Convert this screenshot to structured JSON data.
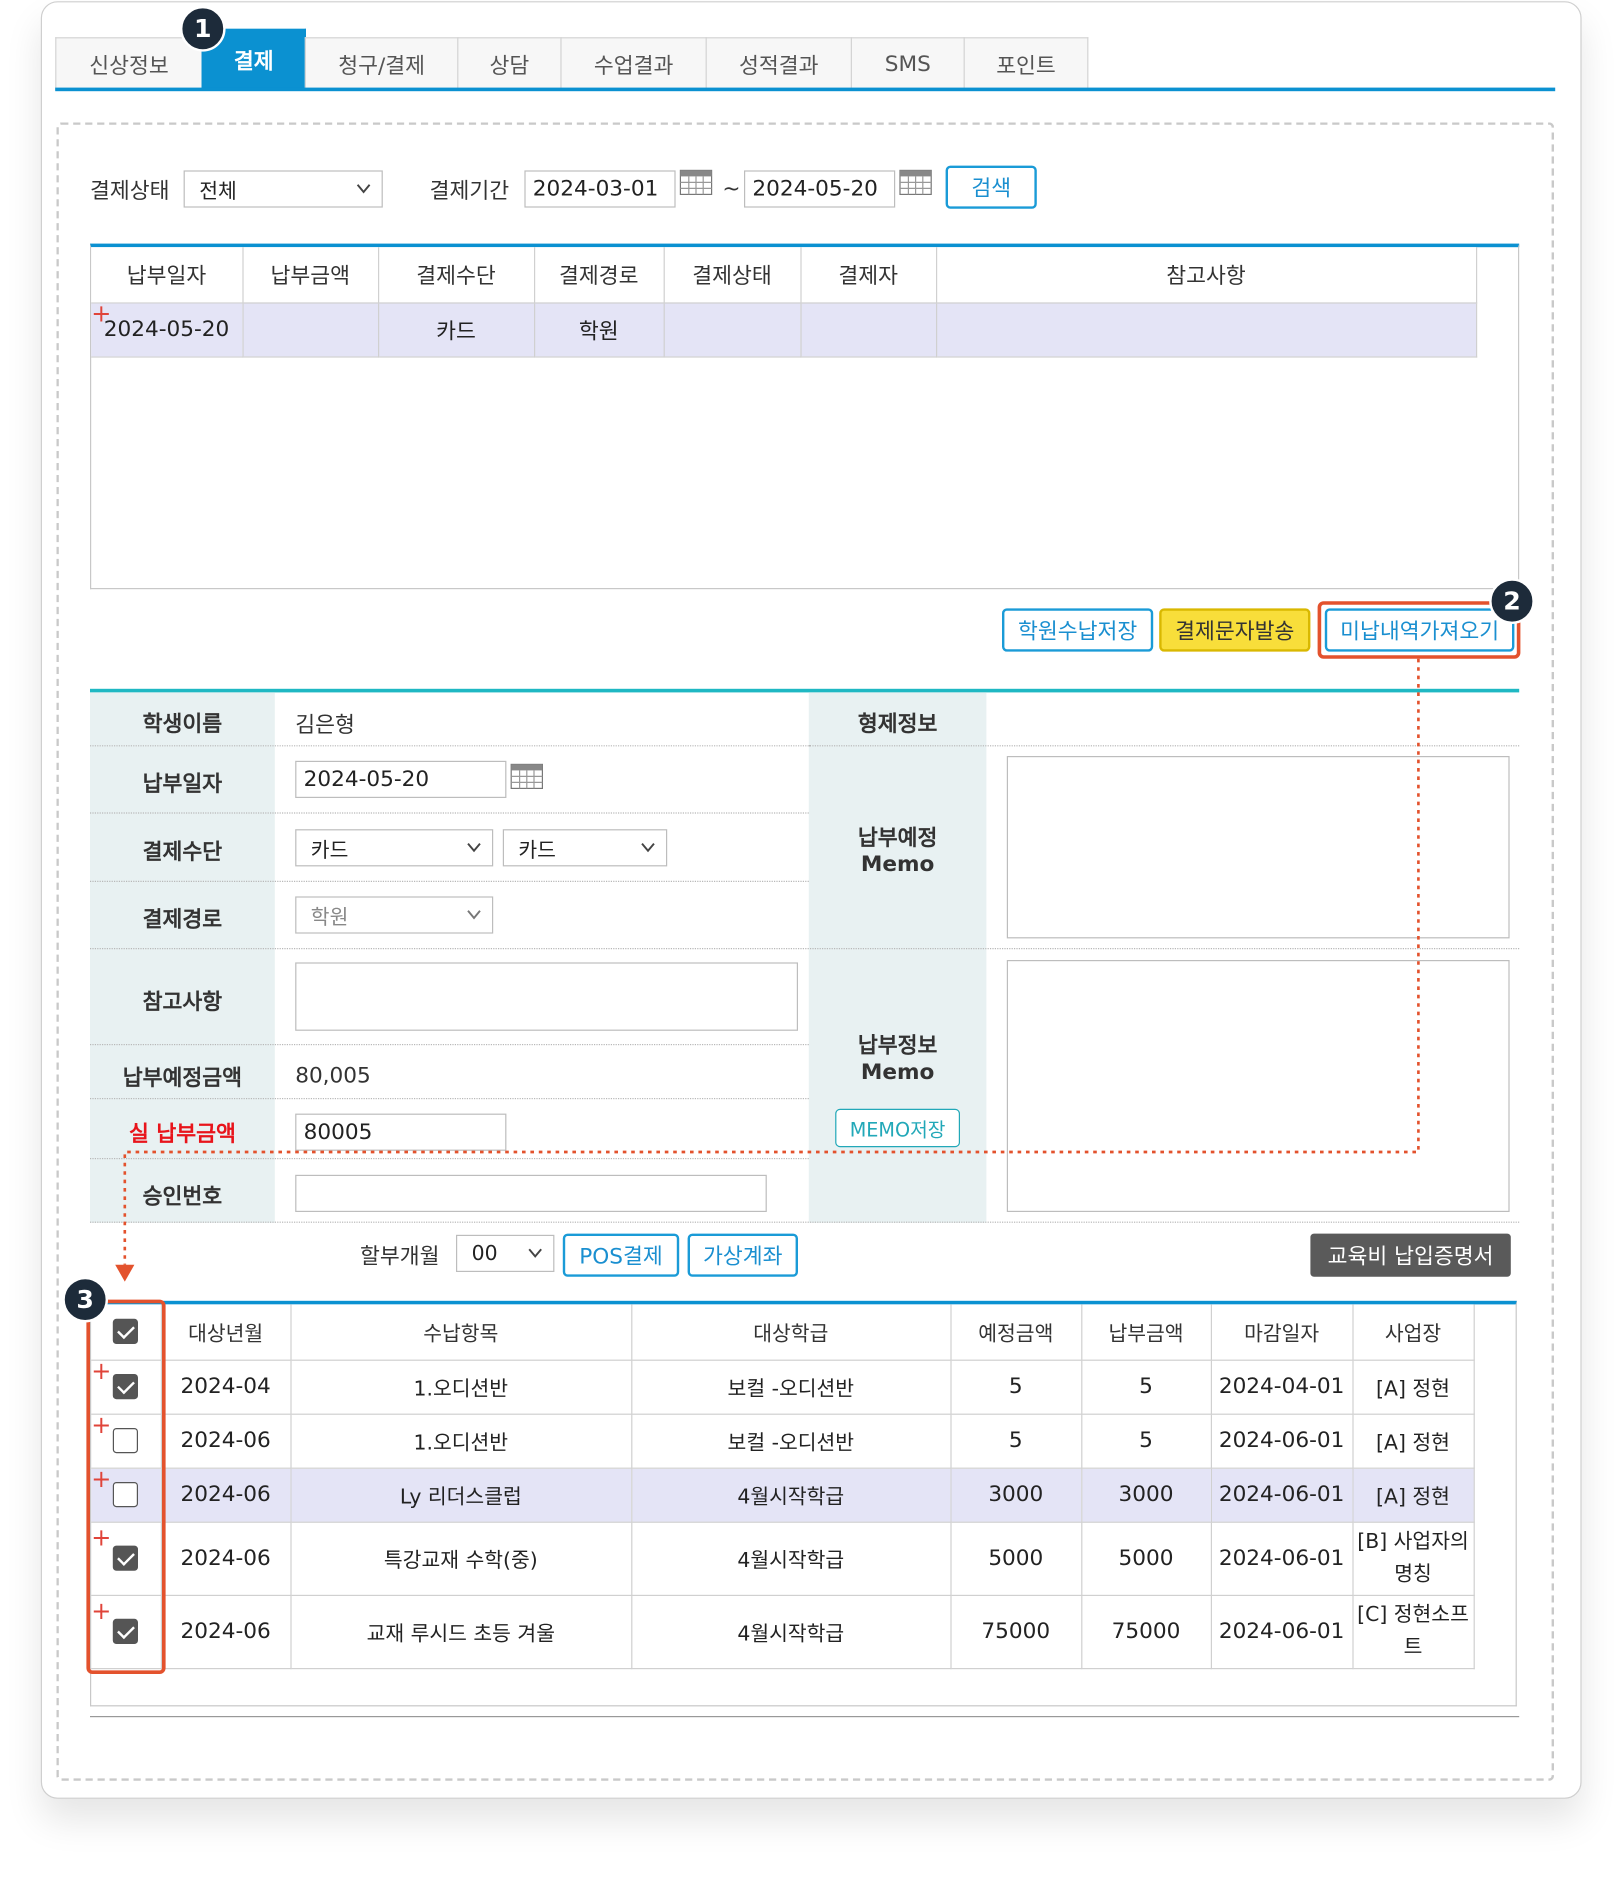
{
  "tabs": [
    {
      "label": "신상정보"
    },
    {
      "label": "결제",
      "active": true
    },
    {
      "label": "청구/결제"
    },
    {
      "label": "상담"
    },
    {
      "label": "수업결과"
    },
    {
      "label": "성적결과"
    },
    {
      "label": "SMS"
    },
    {
      "label": "포인트"
    }
  ],
  "badges": {
    "b1": "1",
    "b2": "2",
    "b3": "3"
  },
  "filter": {
    "status_label": "결제상태",
    "status_value": "전체",
    "period_label": "결제기간",
    "date_from": "2024-03-01",
    "tilde": "~",
    "date_to": "2024-05-20",
    "search_button": "검색"
  },
  "payments_table": {
    "headers": [
      "납부일자",
      "납부금액",
      "결제수단",
      "결제경로",
      "결제상태",
      "결제자",
      "참고사항"
    ],
    "rows": [
      [
        "2024-05-20",
        "",
        "카드",
        "학원",
        "",
        "",
        ""
      ]
    ]
  },
  "actions": {
    "save_receipt": "학원수납저장",
    "send_sms": "결제문자발송",
    "load_unpaid": "미납내역가져오기"
  },
  "form": {
    "student_name_label": "학생이름",
    "student_name": "김은형",
    "sibling_label": "형제정보",
    "pay_date_label": "납부일자",
    "pay_date": "2024-05-20",
    "method_label": "결제수단",
    "method_value_1": "카드",
    "method_value_2": "카드",
    "route_label": "결제경로",
    "route_value": "학원",
    "note_label": "참고사항",
    "planned_amount_label": "납부예정금액",
    "planned_amount": "80,005",
    "actual_amount_label": "실 납부금액",
    "actual_amount": "80005",
    "approval_label": "승인번호",
    "memo1_label_1": "납부예정",
    "memo1_label_2": "Memo",
    "memo2_label_1": "납부정보",
    "memo2_label_2": "Memo",
    "memo_save": "MEMO저장",
    "installment_label": "할부개월",
    "installment_value": "00",
    "pos_button": "POS결제",
    "virtual_account_button": "가상계좌",
    "certificate_button": "교육비 납입증명서"
  },
  "items_table": {
    "headers": [
      "대상년월",
      "수납항목",
      "대상학급",
      "예정금액",
      "납부금액",
      "마감일자",
      "사업장"
    ],
    "rows": [
      {
        "checked": true,
        "month": "2024-04",
        "item": "1.오디션반",
        "class": "보컬 -오디션반",
        "planned": "5",
        "paid": "5",
        "due": "2024-04-01",
        "site": "[A] 정현"
      },
      {
        "checked": false,
        "month": "2024-06",
        "item": "1.오디션반",
        "class": "보컬 -오디션반",
        "planned": "5",
        "paid": "5",
        "due": "2024-06-01",
        "site": "[A] 정현"
      },
      {
        "checked": false,
        "month": "2024-06",
        "item": "Ly 리더스클럽",
        "class": "4월시작학급",
        "planned": "3000",
        "paid": "3000",
        "due": "2024-06-01",
        "site": "[A] 정현"
      },
      {
        "checked": true,
        "month": "2024-06",
        "item": "특강교재 수학(중)",
        "class": "4월시작학급",
        "planned": "5000",
        "paid": "5000",
        "due": "2024-06-01",
        "site_1": "[B] 사업자의",
        "site_2": "명칭"
      },
      {
        "checked": true,
        "month": "2024-06",
        "item": "교재 루시드 초등 겨울",
        "class": "4월시작학급",
        "planned": "75000",
        "paid": "75000",
        "due": "2024-06-01",
        "site_1": "[C] 정현소프",
        "site_2": "트"
      }
    ]
  },
  "colors": {
    "accent": "#0b91d1",
    "highlight": "#e4e4f6",
    "annotation": "#e3522d",
    "form_label_bg": "#e8f1f2"
  }
}
